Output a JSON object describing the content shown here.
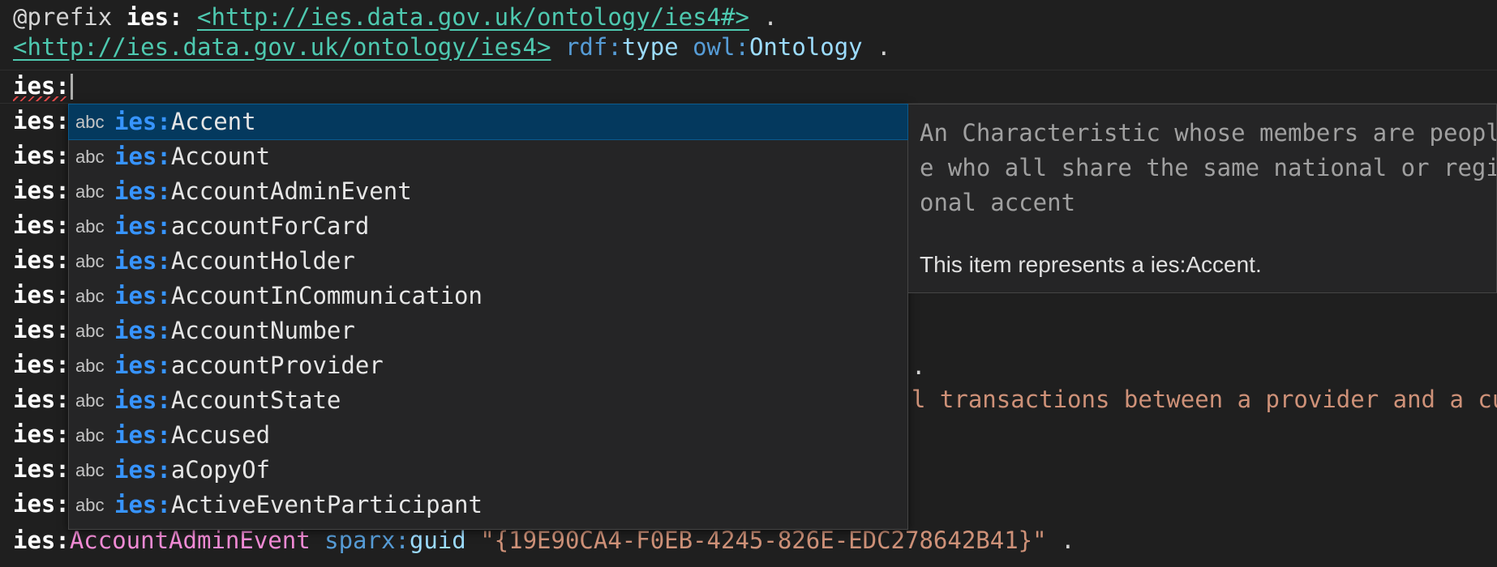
{
  "editor": {
    "line1": {
      "at_prefix": "@prefix",
      "prefix_name": "ies:",
      "iri": "<http://ies.data.gov.uk/ontology/ies4#>",
      "end": "."
    },
    "line2": {
      "iri": "<http://ies.data.gov.uk/ontology/ies4>",
      "p1_prefix": "rdf:",
      "p1_local": "type",
      "p2_prefix": "owl:",
      "p2_local": "Ontology",
      "end": "."
    },
    "current_line_text": "ies:",
    "gutter_prefix": "ies:",
    "visible_fragment_a": ".",
    "visible_fragment_b": "l transactions between a provider and a cu",
    "line_last": {
      "prefix": "ies:",
      "subject": "AccountAdminEvent",
      "pred_prefix": "sparx:",
      "pred_local": "guid",
      "literal": "\"{19E90CA4-F0EB-4245-826E-EDC278642B41}\"",
      "end": "."
    }
  },
  "suggest": {
    "kind_label": "abc",
    "prefix": "ies:",
    "items": [
      "Accent",
      "Account",
      "AccountAdminEvent",
      "accountForCard",
      "AccountHolder",
      "AccountInCommunication",
      "AccountNumber",
      "accountProvider",
      "AccountState",
      "Accused",
      "aCopyOf",
      "ActiveEventParticipant"
    ],
    "selected_index": 0
  },
  "details": {
    "doc_lines": [
      "An Characteristic whose members are peopl",
      "e who all share the same national or regi",
      "onal accent"
    ],
    "type_note": "This item represents a ies:Accent."
  },
  "colors": {
    "background": "#1f1f1f",
    "selection": "#04395e",
    "prefix_blue": "#3794ff",
    "iri_teal": "#4ec9b0",
    "string_orange": "#ce9178",
    "class_pink": "#f28bd6"
  }
}
